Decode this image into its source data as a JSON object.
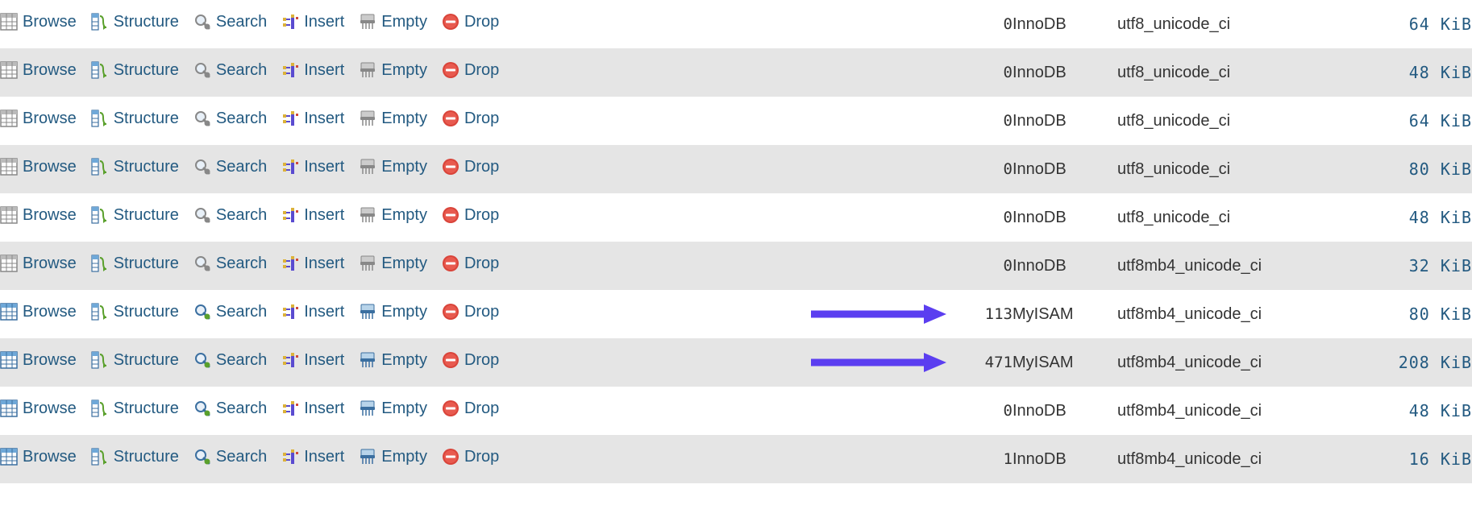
{
  "actions": {
    "browse": "Browse",
    "structure": "Structure",
    "search": "Search",
    "insert": "Insert",
    "empty": "Empty",
    "drop": "Drop"
  },
  "rows": [
    {
      "rows": "0",
      "engine": "InnoDB",
      "collation": "utf8_unicode_ci",
      "size": "64 KiB",
      "style": "gray",
      "arrow": false
    },
    {
      "rows": "0",
      "engine": "InnoDB",
      "collation": "utf8_unicode_ci",
      "size": "48 KiB",
      "style": "gray",
      "arrow": false
    },
    {
      "rows": "0",
      "engine": "InnoDB",
      "collation": "utf8_unicode_ci",
      "size": "64 KiB",
      "style": "gray",
      "arrow": false
    },
    {
      "rows": "0",
      "engine": "InnoDB",
      "collation": "utf8_unicode_ci",
      "size": "80 KiB",
      "style": "gray",
      "arrow": false
    },
    {
      "rows": "0",
      "engine": "InnoDB",
      "collation": "utf8_unicode_ci",
      "size": "48 KiB",
      "style": "gray",
      "arrow": false
    },
    {
      "rows": "0",
      "engine": "InnoDB",
      "collation": "utf8mb4_unicode_ci",
      "size": "32 KiB",
      "style": "gray",
      "arrow": false
    },
    {
      "rows": "113",
      "engine": "MyISAM",
      "collation": "utf8mb4_unicode_ci",
      "size": "80 KiB",
      "style": "blue",
      "arrow": true
    },
    {
      "rows": "471",
      "engine": "MyISAM",
      "collation": "utf8mb4_unicode_ci",
      "size": "208 KiB",
      "style": "blue",
      "arrow": true
    },
    {
      "rows": "0",
      "engine": "InnoDB",
      "collation": "utf8mb4_unicode_ci",
      "size": "48 KiB",
      "style": "blue",
      "arrow": false
    },
    {
      "rows": "1",
      "engine": "InnoDB",
      "collation": "utf8mb4_unicode_ci",
      "size": "16 KiB",
      "style": "blue",
      "arrow": false
    }
  ]
}
